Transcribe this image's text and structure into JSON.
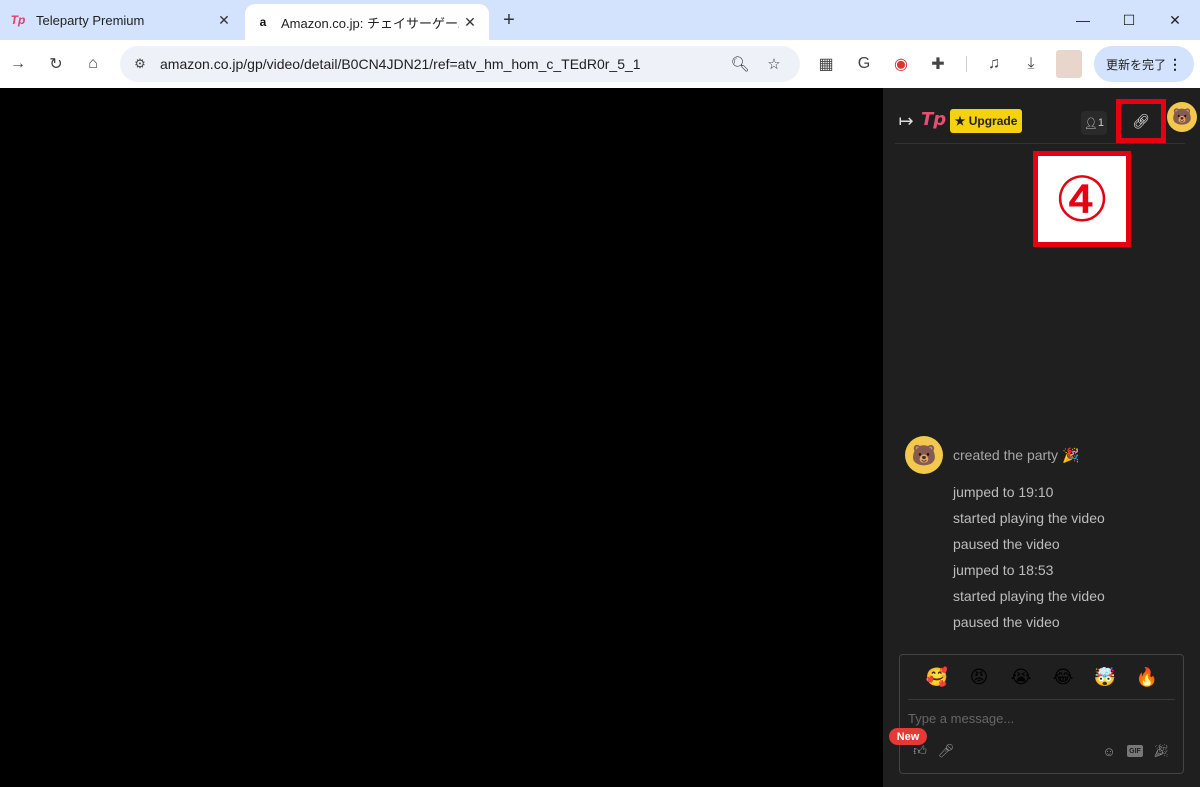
{
  "browser": {
    "tabs": [
      {
        "title": "Teleparty Premium",
        "favicon": "Tp"
      },
      {
        "title": "Amazon.co.jp: チェイサーゲームW /",
        "favicon": "a"
      }
    ],
    "url": "amazon.co.jp/gp/video/detail/B0CN4JDN21/ref=atv_hm_hom_c_TEdR0r_5_1",
    "update_button": "更新を完了"
  },
  "sidebar": {
    "logo": "Tp",
    "upgrade_label": "★ Upgrade",
    "user_count": "1",
    "annotation": "④",
    "feed": {
      "first": "created the party 🎉",
      "events": [
        "jumped to 19:10",
        "started playing the video",
        "paused the video",
        "jumped to 18:53",
        "started playing the video",
        "paused the video"
      ]
    },
    "chat": {
      "placeholder": "Type a message...",
      "new_badge": "New",
      "emojis": [
        "🥰",
        "😡",
        "😭",
        "😂",
        "🤯",
        "🔥"
      ]
    }
  },
  "colors": {
    "accent_red": "#e60012",
    "upgrade_yellow": "#f5d20d",
    "sidebar_bg": "#1f1f1f",
    "tab_strip": "#d3e3fd"
  }
}
